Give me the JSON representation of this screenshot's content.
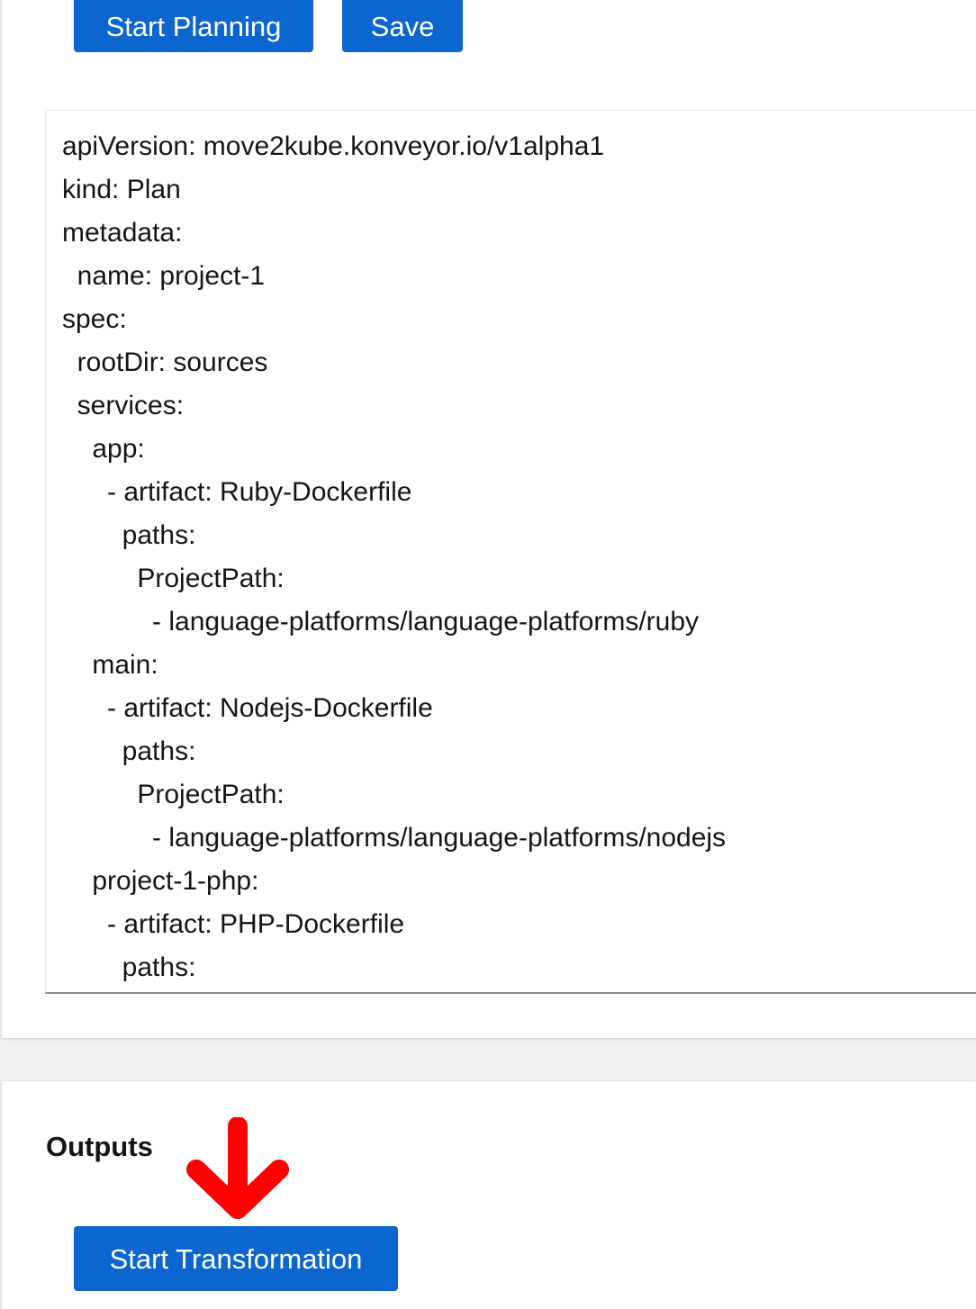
{
  "toolbar": {
    "start_planning_label": "Start Planning",
    "save_label": "Save"
  },
  "plan_editor": {
    "content": "apiVersion: move2kube.konveyor.io/v1alpha1\nkind: Plan\nmetadata:\n  name: project-1\nspec:\n  rootDir: sources\n  services:\n    app:\n      - artifact: Ruby-Dockerfile\n        paths:\n          ProjectPath:\n            - language-platforms/language-platforms/ruby\n    main:\n      - artifact: Nodejs-Dockerfile\n        paths:\n          ProjectPath:\n            - language-platforms/language-platforms/nodejs\n    project-1-php:\n      - artifact: PHP-Dockerfile\n        paths:"
  },
  "outputs": {
    "title": "Outputs",
    "start_transformation_label": "Start Transformation"
  },
  "annotation": {
    "icon": "arrow-down-icon",
    "color": "#ff0000"
  },
  "colors": {
    "primary_button": "#0b66d0",
    "background": "#f0f0f0"
  }
}
